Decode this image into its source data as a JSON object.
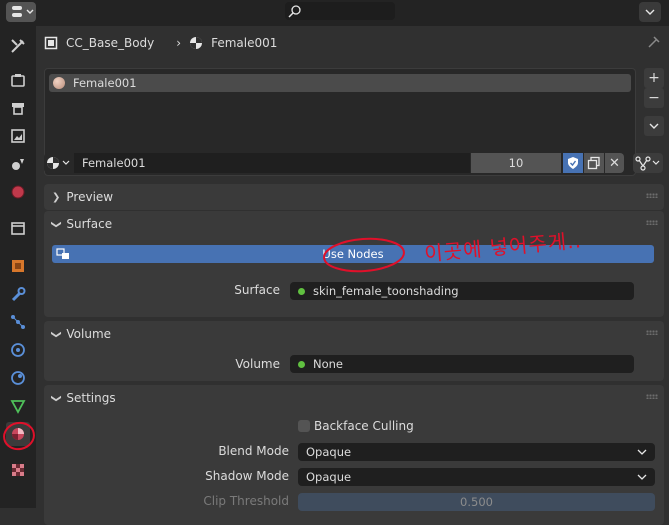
{
  "header": {
    "editor_type_icon": "properties-editor-icon",
    "search_icon": "search-icon"
  },
  "tabs": [
    {
      "name": "tool",
      "icon": "wrench-screwdriver-icon"
    },
    {
      "name": "render",
      "icon": "camera-back-icon"
    },
    {
      "name": "output",
      "icon": "printer-icon"
    },
    {
      "name": "view-layer",
      "icon": "image-icon"
    },
    {
      "name": "scene",
      "icon": "scene-icon"
    },
    {
      "name": "world",
      "icon": "world-icon"
    },
    {
      "name": "collection",
      "icon": "collection-box-icon"
    },
    {
      "name": "object",
      "icon": "object-square-icon"
    },
    {
      "name": "modifiers",
      "icon": "wrench-icon"
    },
    {
      "name": "particles",
      "icon": "particles-icon"
    },
    {
      "name": "physics",
      "icon": "physics-orbit-icon"
    },
    {
      "name": "constraints",
      "icon": "constraint-icon"
    },
    {
      "name": "data",
      "icon": "triangle-mesh-icon"
    },
    {
      "name": "material",
      "icon": "material-sphere-icon"
    },
    {
      "name": "texture",
      "icon": "checker-icon"
    }
  ],
  "breadcrumb": {
    "object": "CC_Base_Body",
    "material": "Female001"
  },
  "slots": {
    "items": [
      "Female001"
    ]
  },
  "material_selector": {
    "name": "Female001",
    "users": "10"
  },
  "sections": {
    "preview": "Preview",
    "surface": "Surface",
    "volume": "Volume",
    "settings": "Settings"
  },
  "surface": {
    "use_nodes_label": "Use Nodes",
    "surface_label": "Surface",
    "surface_value": "skin_female_toonshading",
    "annotation": "이곳에 넣어주게.."
  },
  "volume": {
    "label": "Volume",
    "value": "None"
  },
  "settings": {
    "backface_culling_label": "Backface Culling",
    "blend_mode_label": "Blend Mode",
    "blend_mode_value": "Opaque",
    "shadow_mode_label": "Shadow Mode",
    "shadow_mode_value": "Opaque",
    "clip_threshold_label": "Clip Threshold",
    "clip_threshold_value": "0.500"
  },
  "colors": {
    "accent_blue": "#4772b3",
    "annotation_red": "#e0102a",
    "socket_green": "#60c040"
  }
}
